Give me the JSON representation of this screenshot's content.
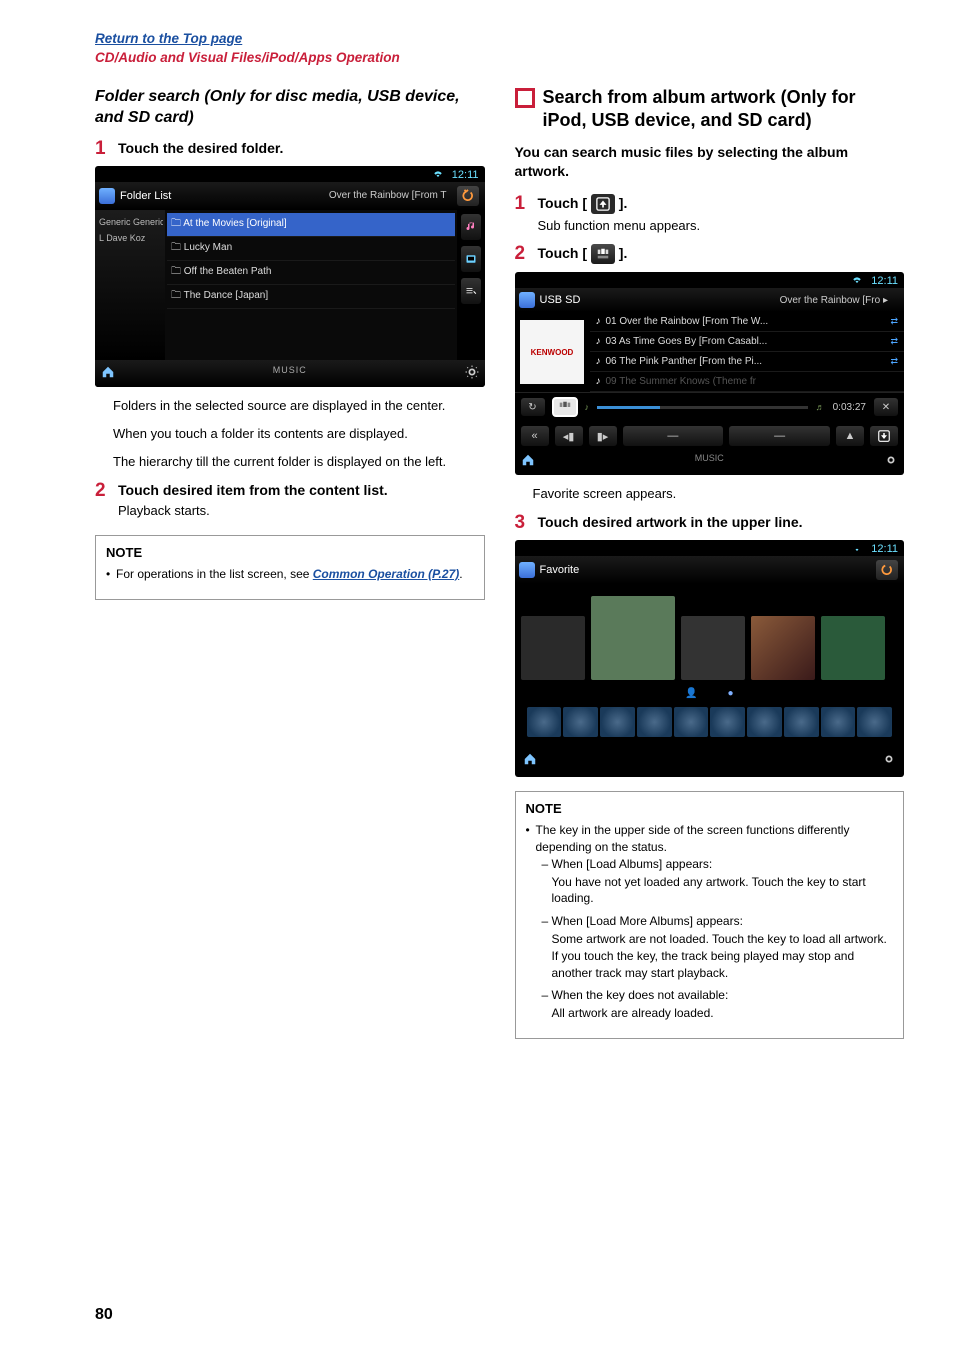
{
  "header": {
    "top_link": "Return to the Top page",
    "section_name": "CD/Audio and Visual Files/iPod/Apps Operation"
  },
  "left": {
    "section_title": "Folder search (Only for disc media, USB device, and SD card)",
    "step1": {
      "num": "1",
      "head": "Touch the desired folder."
    },
    "shot1": {
      "time": "12:11",
      "title": "Folder List",
      "now_playing": "Over the Rainbow [From T",
      "hierarchy": [
        "Generic Generic",
        "Dave Koz"
      ],
      "hier_prefix": "L",
      "items": [
        "At the Movies [Original]",
        "Lucky Man",
        "Off the Beaten Path",
        "The Dance [Japan]"
      ],
      "footer_label": "MUSIC"
    },
    "body_paragraphs": [
      "Folders in the selected source are displayed in the center.",
      "When you touch a folder its contents are displayed.",
      "The hierarchy till the current folder is displayed on the left."
    ],
    "step2": {
      "num": "2",
      "head": "Touch desired item from the content list.",
      "sub": "Playback starts."
    },
    "note": {
      "title": "NOTE",
      "item_prefix": "For operations in the list screen, see ",
      "link_text": "Common Operation (P.27)",
      "suffix": "."
    }
  },
  "right": {
    "h2": "Search from album artwork (Only for iPod, USB device, and SD card)",
    "intro": "You can search music files by selecting the album artwork.",
    "step1": {
      "num": "1",
      "head_prefix": "Touch [",
      "head_suffix": "].",
      "sub": "Sub function menu appears."
    },
    "step2": {
      "num": "2",
      "head_prefix": "Touch [",
      "head_suffix": "]."
    },
    "shot2": {
      "time": "12:11",
      "title": "USB SD",
      "now_playing": "Over the Rainbow [Fro",
      "art_label": "KENWOOD",
      "tracks": [
        "01 Over the Rainbow [From The W...",
        "03 As Time Goes By [From Casabl...",
        "06 The Pink Panther [From the Pi...",
        "09 The Summer Knows (Theme fr"
      ],
      "playtime": "0:03:27",
      "footer_label": "MUSIC"
    },
    "after_shot2": "Favorite screen appears.",
    "step3": {
      "num": "3",
      "head": "Touch desired artwork in the upper line."
    },
    "shot3": {
      "time": "12:11",
      "title": "Favorite"
    },
    "note2": {
      "title": "NOTE",
      "main": "The key in the upper side of the screen functions differently depending on the status.",
      "sub1": {
        "head": "When [Load Albums] appears:",
        "body": "You have not yet loaded any artwork. Touch the key to start loading."
      },
      "sub2": {
        "head": "When [Load More Albums] appears:",
        "body": "Some artwork are not loaded. Touch the key to load all artwork. If you touch the key, the track being played may stop and another track may start playback."
      },
      "sub3": {
        "head": "When the key does not available:",
        "body": "All artwork are already loaded."
      }
    }
  },
  "page_number": "80"
}
